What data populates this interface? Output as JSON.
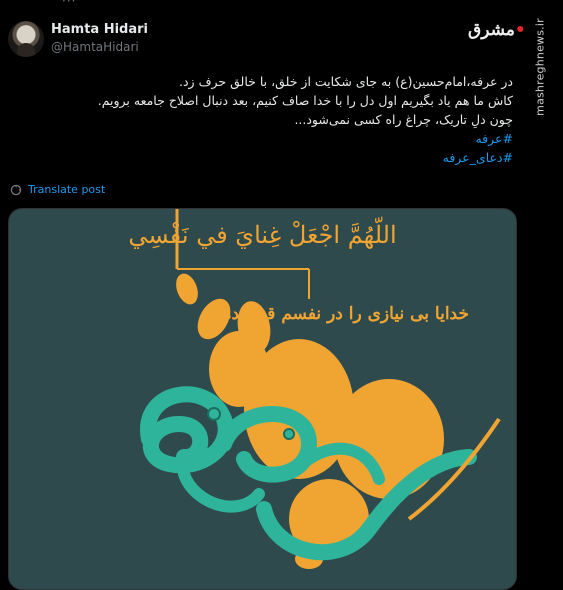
{
  "top_dots": "···",
  "author": {
    "name": "Hamta Hidari",
    "handle": "@HamtaHidari"
  },
  "logo": {
    "text": "مشرق"
  },
  "watermark": {
    "text": "mashreghnews.ir"
  },
  "tweet": {
    "line1": "در عرفه،امام‌حسین(ع) به جای شکایت از خلق، با خالق حرف زد.",
    "line2": "کاش ما هم یاد بگیریم اول دل را با خدا صاف کنیم، بعد دنبال اصلاح جامعه برویم.",
    "line3": "چون دلِ تاریک، چراغ راه کسی نمی‌شود...",
    "hashtags": [
      "#عرفه",
      "#دعای_عرفه"
    ]
  },
  "translate_label": "Translate post",
  "image": {
    "arabic_title": "اللّهُمَّ اجْعَلْ غِنايَ في نَفْسِي",
    "persian_subtitle": "خدایا بی نیازی را در نفسم قرار ده",
    "calligraphy": "عرفه"
  },
  "colors": {
    "background": "#000000",
    "text": "#e7e9ea",
    "muted": "#71767b",
    "link": "#1d9bf0",
    "card_bg": "#2f4a4c",
    "gold": "#f0a432",
    "teal": "#2fb49c"
  },
  "icons": {
    "translate": "globe-translate-icon"
  }
}
